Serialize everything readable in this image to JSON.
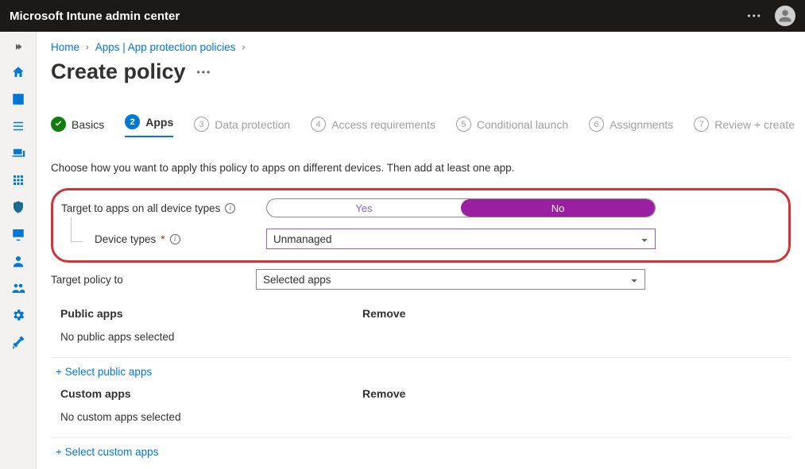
{
  "topbar": {
    "title": "Microsoft Intune admin center"
  },
  "breadcrumb": {
    "home": "Home",
    "apps": "Apps | App protection policies"
  },
  "page": {
    "title": "Create policy"
  },
  "steps": [
    {
      "label": "Basics"
    },
    {
      "num": "2",
      "label": "Apps"
    },
    {
      "num": "3",
      "label": "Data protection"
    },
    {
      "num": "4",
      "label": "Access requirements"
    },
    {
      "num": "5",
      "label": "Conditional launch"
    },
    {
      "num": "6",
      "label": "Assignments"
    },
    {
      "num": "7",
      "label": "Review + create"
    }
  ],
  "intro": "Choose how you want to apply this policy to apps on different devices. Then add at least one app.",
  "fields": {
    "target_all_label": "Target to apps on all device types",
    "toggle_yes": "Yes",
    "toggle_no": "No",
    "device_types_label": "Device types",
    "device_types_value": "Unmanaged",
    "target_policy_label": "Target policy to",
    "target_policy_value": "Selected apps"
  },
  "public": {
    "header": "Public apps",
    "remove": "Remove",
    "empty": "No public apps selected",
    "link": "+ Select public apps"
  },
  "custom": {
    "header": "Custom apps",
    "remove": "Remove",
    "empty": "No custom apps selected",
    "link": "+ Select custom apps"
  }
}
